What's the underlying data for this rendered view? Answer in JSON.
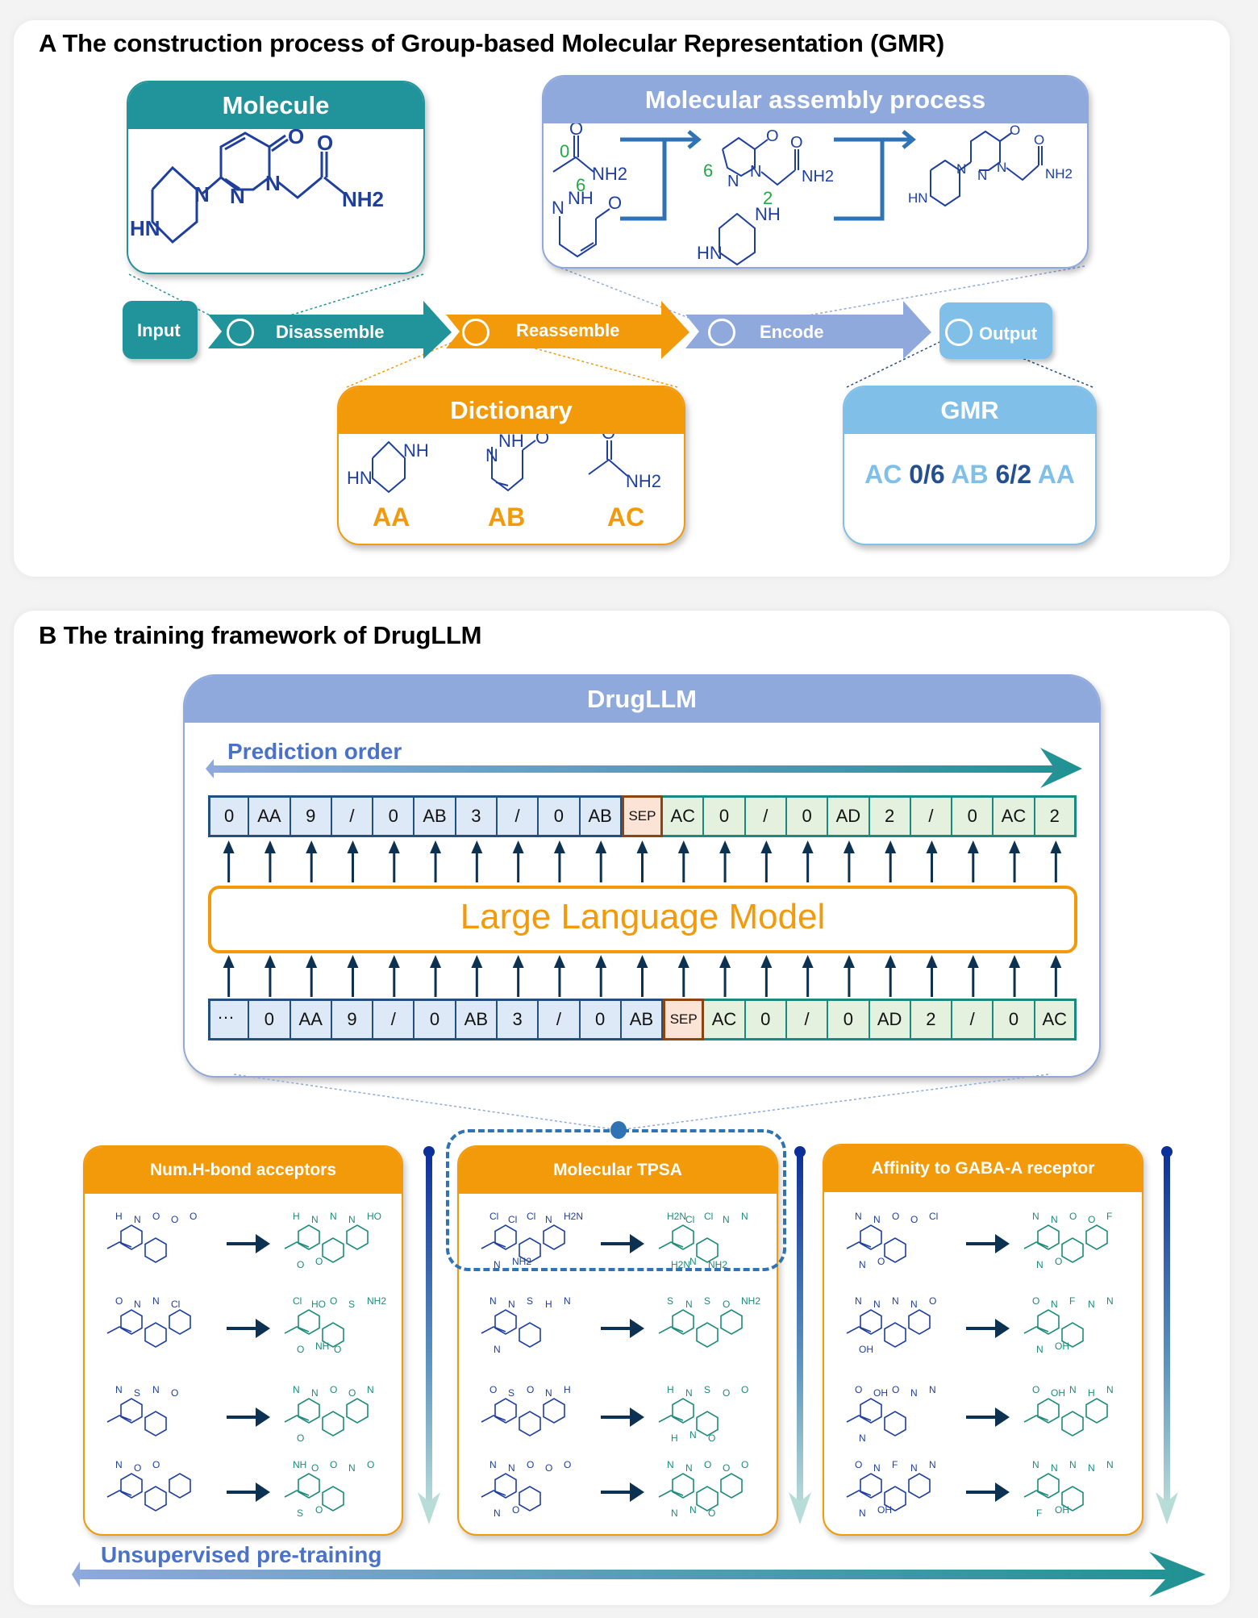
{
  "panel_a": {
    "title": "A The construction process of Group-based Molecular Representation (GMR)",
    "molecule_card": {
      "title": "Molecule",
      "atoms": [
        "O",
        "O",
        "N",
        "N",
        "N",
        "NH2",
        "HN"
      ]
    },
    "assembly_card": {
      "title": "Molecular assembly process",
      "step1_fragments": [
        {
          "atoms": [
            "O",
            "NH2"
          ],
          "index_label": "0"
        },
        {
          "atoms": [
            "N",
            "NH",
            "O"
          ],
          "index_label": "6"
        }
      ],
      "step2_fragments": [
        {
          "atoms": [
            "O",
            "O",
            "N",
            "N",
            "NH2"
          ],
          "index_label": "6"
        },
        {
          "atoms": [
            "NH",
            "HN"
          ],
          "index_label": "2"
        }
      ],
      "step3_product": {
        "atoms": [
          "O",
          "O",
          "N",
          "N",
          "N",
          "NH2",
          "HN"
        ]
      }
    },
    "flow": {
      "input": "Input",
      "disassemble": "Disassemble",
      "reassemble": "Reassemble",
      "encode": "Encode",
      "output": "Output"
    },
    "dictionary_card": {
      "title": "Dictionary",
      "entries": [
        {
          "code": "AA",
          "atoms": [
            "NH",
            "HN"
          ]
        },
        {
          "code": "AB",
          "atoms": [
            "N",
            "NH",
            "O"
          ]
        },
        {
          "code": "AC",
          "atoms": [
            "O",
            "NH2"
          ]
        }
      ]
    },
    "gmr_card": {
      "title": "GMR",
      "sequence": [
        {
          "text": "AC",
          "kind": "group"
        },
        {
          "text": "0/6",
          "kind": "index"
        },
        {
          "text": "AB",
          "kind": "group"
        },
        {
          "text": "6/2",
          "kind": "index"
        },
        {
          "text": "AA",
          "kind": "group"
        }
      ]
    }
  },
  "panel_b": {
    "title": "B The training framework of DrugLLM",
    "drugllm_card": {
      "title": "DrugLLM",
      "prediction_order_label": "Prediction order",
      "model_label": "Large Language Model",
      "output_tokens": [
        {
          "t": "0",
          "k": "blue"
        },
        {
          "t": "AA",
          "k": "blue"
        },
        {
          "t": "9",
          "k": "blue"
        },
        {
          "t": "/",
          "k": "blue"
        },
        {
          "t": "0",
          "k": "blue"
        },
        {
          "t": "AB",
          "k": "blue"
        },
        {
          "t": "3",
          "k": "blue"
        },
        {
          "t": "/",
          "k": "blue"
        },
        {
          "t": "0",
          "k": "blue"
        },
        {
          "t": "AB",
          "k": "blue"
        },
        {
          "t": "SEP",
          "k": "sep"
        },
        {
          "t": "AC",
          "k": "green"
        },
        {
          "t": "0",
          "k": "green"
        },
        {
          "t": "/",
          "k": "green"
        },
        {
          "t": "0",
          "k": "green"
        },
        {
          "t": "AD",
          "k": "green"
        },
        {
          "t": "2",
          "k": "green"
        },
        {
          "t": "/",
          "k": "green"
        },
        {
          "t": "0",
          "k": "green"
        },
        {
          "t": "AC",
          "k": "green"
        },
        {
          "t": "2",
          "k": "green"
        }
      ],
      "input_tokens": [
        {
          "t": "…",
          "k": "blue"
        },
        {
          "t": "0",
          "k": "blue"
        },
        {
          "t": "AA",
          "k": "blue"
        },
        {
          "t": "9",
          "k": "blue"
        },
        {
          "t": "/",
          "k": "blue"
        },
        {
          "t": "0",
          "k": "blue"
        },
        {
          "t": "AB",
          "k": "blue"
        },
        {
          "t": "3",
          "k": "blue"
        },
        {
          "t": "/",
          "k": "blue"
        },
        {
          "t": "0",
          "k": "blue"
        },
        {
          "t": "AB",
          "k": "blue"
        },
        {
          "t": "SEP",
          "k": "sep"
        },
        {
          "t": "AC",
          "k": "green"
        },
        {
          "t": "0",
          "k": "green"
        },
        {
          "t": "/",
          "k": "green"
        },
        {
          "t": "0",
          "k": "green"
        },
        {
          "t": "AD",
          "k": "green"
        },
        {
          "t": "2",
          "k": "green"
        },
        {
          "t": "/",
          "k": "green"
        },
        {
          "t": "0",
          "k": "green"
        },
        {
          "t": "AC",
          "k": "green"
        }
      ]
    },
    "tasks": [
      {
        "title": "Num.H-bond acceptors",
        "pairs": [
          {
            "source_atoms": [
              "H",
              "N",
              "O",
              "O",
              "O"
            ],
            "target_atoms": [
              "H",
              "N",
              "N",
              "N",
              "HO",
              "O",
              "O"
            ]
          },
          {
            "source_atoms": [
              "O",
              "N",
              "N",
              "Cl"
            ],
            "target_atoms": [
              "Cl",
              "HO",
              "O",
              "S",
              "NH2",
              "O",
              "NH",
              "O"
            ]
          },
          {
            "source_atoms": [
              "N",
              "S",
              "N",
              "O"
            ],
            "target_atoms": [
              "N",
              "N",
              "O",
              "O",
              "N",
              "O"
            ]
          },
          {
            "source_atoms": [
              "N",
              "O",
              "O"
            ],
            "target_atoms": [
              "NH",
              "O",
              "O",
              "N",
              "O",
              "S",
              "O"
            ]
          }
        ]
      },
      {
        "title": "Molecular TPSA",
        "pairs": [
          {
            "source_atoms": [
              "Cl",
              "Cl",
              "Cl",
              "N",
              "H2N",
              "N",
              "NH2"
            ],
            "target_atoms": [
              "H2N",
              "Cl",
              "Cl",
              "N",
              "N",
              "H2N",
              "N",
              "NH2"
            ]
          },
          {
            "source_atoms": [
              "N",
              "N",
              "S",
              "H",
              "N",
              "N"
            ],
            "target_atoms": [
              "S",
              "N",
              "S",
              "O",
              "NH2"
            ]
          },
          {
            "source_atoms": [
              "O",
              "S",
              "O",
              "N",
              "H"
            ],
            "target_atoms": [
              "H",
              "N",
              "S",
              "O",
              "O",
              "H",
              "N",
              "O"
            ]
          },
          {
            "source_atoms": [
              "N",
              "N",
              "O",
              "O",
              "O",
              "N",
              "O"
            ],
            "target_atoms": [
              "N",
              "N",
              "O",
              "O",
              "O",
              "N",
              "N",
              "O"
            ]
          }
        ]
      },
      {
        "title": "Affinity to GABA-A receptor",
        "pairs": [
          {
            "source_atoms": [
              "N",
              "N",
              "O",
              "O",
              "Cl",
              "N",
              "O"
            ],
            "target_atoms": [
              "N",
              "N",
              "O",
              "O",
              "F",
              "N",
              "O"
            ]
          },
          {
            "source_atoms": [
              "N",
              "N",
              "N",
              "N",
              "O",
              "OH"
            ],
            "target_atoms": [
              "O",
              "N",
              "F",
              "N",
              "N",
              "N",
              "OH"
            ]
          },
          {
            "source_atoms": [
              "O",
              "OH",
              "O",
              "N",
              "N",
              "N"
            ],
            "target_atoms": [
              "O",
              "OH",
              "N",
              "H",
              "N"
            ]
          },
          {
            "source_atoms": [
              "O",
              "N",
              "F",
              "N",
              "N",
              "N",
              "OH"
            ],
            "target_atoms": [
              "N",
              "N",
              "N",
              "N",
              "N",
              "F",
              "OH"
            ]
          }
        ]
      }
    ],
    "pretraining_label": "Unsupervised pre-training"
  },
  "colors": {
    "teal": "#21939a",
    "orange": "#f29a0a",
    "periwinkle": "#8fa9dc",
    "sky": "#7fbfe8",
    "mol_blue": "#1f3f9e",
    "mol_green": "#1e8b7a",
    "index_green": "#22a845",
    "gmr_dark": "#244f91",
    "label_blue": "#4a72c8",
    "arrow_dark": "#0d3150"
  }
}
